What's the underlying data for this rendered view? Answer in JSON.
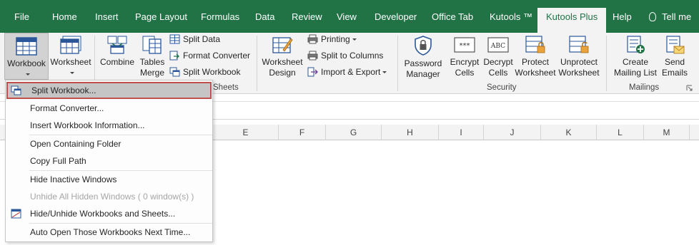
{
  "tabs": [
    "File",
    "Home",
    "Insert",
    "Page Layout",
    "Formulas",
    "Data",
    "Review",
    "View",
    "Developer",
    "Office Tab",
    "Kutools ™",
    "Kutools Plus",
    "Help"
  ],
  "active_tab": "Kutools Plus",
  "tell_me": "Tell me",
  "ribbon": {
    "workbook": "Workbook",
    "worksheet": "Worksheet",
    "combine": "Combine",
    "tables_merge_1": "Tables",
    "tables_merge_2": "Merge",
    "split_data": "Split Data",
    "format_converter": "Format Converter",
    "split_workbook": "Split Workbook",
    "group_sheets": "Sheets",
    "worksheet_design_1": "Worksheet",
    "worksheet_design_2": "Design",
    "printing": "Printing",
    "split_to_columns": "Split to Columns",
    "import_export": "Import & Export",
    "password_manager_1": "Password",
    "password_manager_2": "Manager",
    "encrypt_cells_1": "Encrypt",
    "encrypt_cells_2": "Cells",
    "decrypt_cells_1": "Decrypt",
    "decrypt_cells_2": "Cells",
    "protect_ws_1": "Protect",
    "protect_ws_2": "Worksheet",
    "unprotect_ws_1": "Unprotect",
    "unprotect_ws_2": "Worksheet",
    "group_security": "Security",
    "create_mailing_1": "Create",
    "create_mailing_2": "Mailing List",
    "send_emails_1": "Send",
    "send_emails_2": "Emails",
    "group_mailings": "Mailings"
  },
  "columns": [
    "E",
    "F",
    "G",
    "H",
    "I",
    "J",
    "K",
    "L",
    "M"
  ],
  "menu": {
    "items": [
      {
        "label": "Split Workbook...",
        "icon": "split-workbook-icon",
        "state": "highlighted"
      },
      {
        "label": "Format Converter...",
        "state": "normal"
      },
      {
        "label": "Insert Workbook Information...",
        "state": "normal"
      },
      {
        "label": "Open Containing Folder",
        "state": "normal"
      },
      {
        "label": "Copy Full Path",
        "state": "normal"
      },
      {
        "label": "Hide Inactive Windows",
        "state": "normal"
      },
      {
        "label": "Unhide All Hidden Windows ( 0 window(s) )",
        "state": "disabled"
      },
      {
        "label": "Hide/Unhide Workbooks and Sheets...",
        "icon": "hide-unhide-icon",
        "state": "normal"
      },
      {
        "label": "Auto Open Those Workbooks Next Time...",
        "state": "normal"
      }
    ]
  },
  "colors": {
    "tab_bar": "#217346",
    "ribbon_bg": "#f3f3f3",
    "highlight_border": "#c0504d"
  }
}
